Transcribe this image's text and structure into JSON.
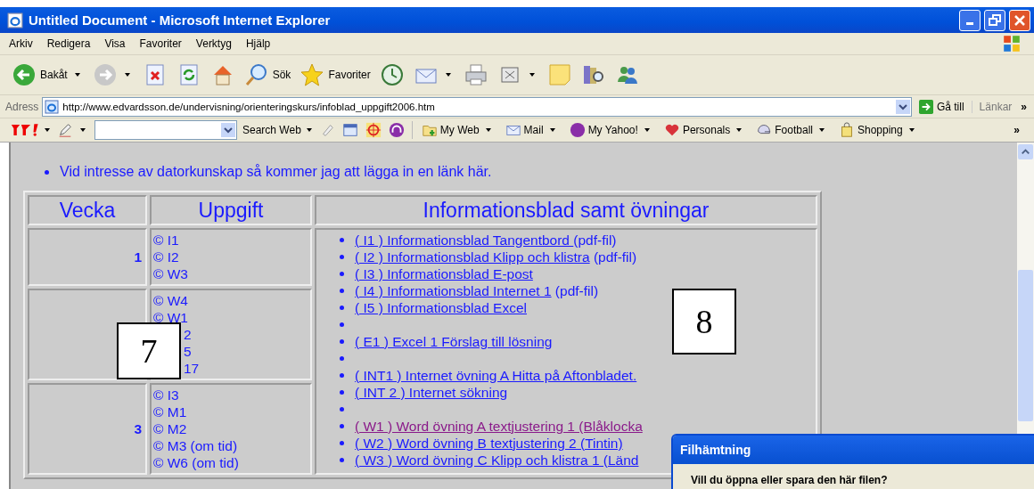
{
  "window": {
    "title": "Untitled Document - Microsoft Internet Explorer"
  },
  "menu": [
    "Arkiv",
    "Redigera",
    "Visa",
    "Favoriter",
    "Verktyg",
    "Hjälp"
  ],
  "toolbar": [
    {
      "kind": "back",
      "label": "Bakåt",
      "dropdown": true
    },
    {
      "kind": "forward",
      "dropdown": true
    },
    {
      "kind": "stop"
    },
    {
      "kind": "refresh"
    },
    {
      "kind": "home"
    },
    {
      "kind": "search",
      "label": "Sök"
    },
    {
      "kind": "favorites",
      "label": "Favoriter"
    },
    {
      "kind": "history"
    },
    {
      "kind": "mail",
      "dropdown": true
    },
    {
      "kind": "print"
    },
    {
      "kind": "edit",
      "dropdown": true
    },
    {
      "kind": "note"
    },
    {
      "kind": "research"
    },
    {
      "kind": "messenger"
    }
  ],
  "address": {
    "label": "Adress",
    "value": "http://www.edvardsson.de/undervisning/orienteringskurs/infoblad_uppgift2006.htm",
    "go": "Gå till",
    "links": "Länkar",
    "more": "»"
  },
  "yahoo": {
    "search_button": "Search Web",
    "items": [
      {
        "kind": "myweb",
        "label": "My Web"
      },
      {
        "kind": "mail",
        "label": "Mail"
      },
      {
        "kind": "myyahoo",
        "label": "My Yahoo!"
      },
      {
        "kind": "personals",
        "label": "Personals"
      },
      {
        "kind": "football",
        "label": "Football"
      },
      {
        "kind": "shopping",
        "label": "Shopping"
      }
    ],
    "more": "»"
  },
  "intro": "Vid intresse av datorkunskap så kommer jag att lägga in en länk här.",
  "table": {
    "columns": [
      "Vecka",
      "Uppgift",
      "Informationsblad samt övningar"
    ],
    "rows": [
      {
        "week": "1",
        "tasks": [
          {
            "kind": "full",
            "text": "© I1"
          },
          {
            "kind": "full",
            "text": "© I2"
          },
          {
            "kind": "full",
            "text": "© W3"
          }
        ]
      },
      {
        "tasks": [
          {
            "kind": "full",
            "text": "© W4"
          },
          {
            "kind": "full",
            "text": "© W1"
          },
          {
            "kind": "partial",
            "text": "2"
          },
          {
            "kind": "partial",
            "text": "5"
          },
          {
            "kind": "partial",
            "text": "17"
          }
        ]
      },
      {
        "week": "3",
        "tasks": [
          {
            "kind": "full",
            "text": "© I3"
          },
          {
            "kind": "full",
            "text": "© M1"
          },
          {
            "kind": "full",
            "text": "© M2"
          },
          {
            "kind": "full",
            "text": "© M3 (om tid)"
          },
          {
            "kind": "full",
            "text": "© W6 (om tid)"
          }
        ]
      }
    ],
    "links": [
      {
        "kind": "link",
        "text": "( I1 ) Informationsblad Tangentbord ",
        "suffix": "(pdf-fil)",
        "visited": false
      },
      {
        "kind": "link",
        "text": "( I2 ) Informationsblad Klipp och klistra",
        "suffix": " (pdf-fil)",
        "visited": false
      },
      {
        "kind": "link",
        "text": "( I3 ) Informationsblad E-post",
        "visited": false
      },
      {
        "kind": "link",
        "text": "( I4 ) Informationsblad Internet 1",
        "suffix": " (pdf-fil)",
        "visited": false
      },
      {
        "kind": "link",
        "text": "( I5 ) Informationsblad Excel",
        "visited": false
      },
      {
        "kind": "blank"
      },
      {
        "kind": "link",
        "text": "( E1 ) Excel 1 Förslag till lösning",
        "visited": false
      },
      {
        "kind": "blank"
      },
      {
        "kind": "link",
        "text": "( INT1 ) Internet övning A Hitta på Aftonbladet.",
        "visited": false
      },
      {
        "kind": "link",
        "text": "( INT 2 ) Internet sökning",
        "visited": false
      },
      {
        "kind": "blank"
      },
      {
        "kind": "link",
        "text": "( W1 ) Word övning A textjustering 1 (Blåklocka",
        "visited": true
      },
      {
        "kind": "link",
        "text": "( W2 ) Word övning B textjustering 2 (Tintin)",
        "visited": false
      },
      {
        "kind": "link",
        "text": "( W3 ) Word övning C Klipp och klistra 1 (Länd",
        "visited": false
      }
    ]
  },
  "callouts": [
    "7",
    "8"
  ],
  "dialog": {
    "title": "Filhämtning",
    "question": "Vill du öppna eller spara den här filen?"
  }
}
